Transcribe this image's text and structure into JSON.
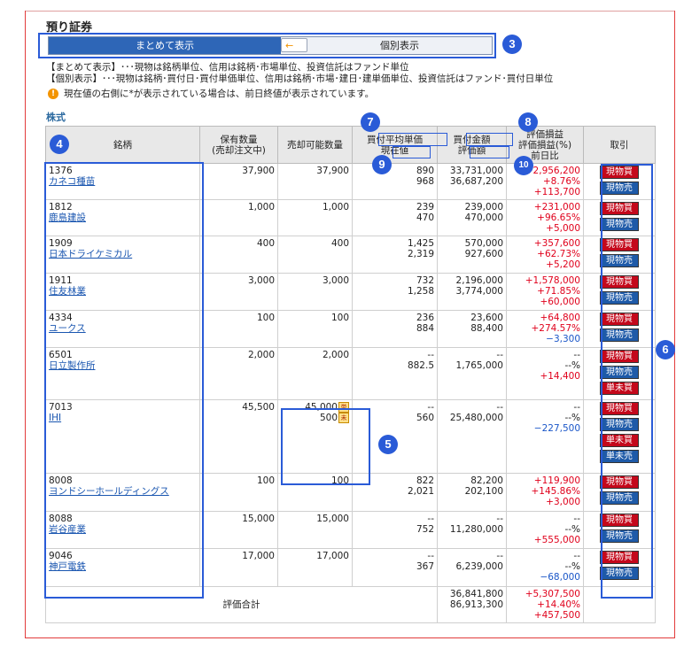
{
  "title": "預り証券",
  "toggle": {
    "left_label": "まとめて表示",
    "right_label": "個別表示",
    "arrow": "←"
  },
  "notes": [
    "【まとめて表示】･･･現物は銘柄単位、信用は銘柄･市場単位、投資信託はファンド単位",
    "【個別表示】･･･現物は銘柄･買付日･買付単価単位、信用は銘柄･市場･建日･建単価単位、投資信託はファンド･買付日単位"
  ],
  "warning": "現在値の右側に*が表示されている場合は、前日終値が表示されています。",
  "section_label": "株式",
  "headers": {
    "name": "銘柄",
    "holdings": [
      "保有数量",
      "(売却注文中)"
    ],
    "sellable": "売却可能数量",
    "avg_price": "買付平均単価",
    "current_price": "現在値",
    "purchase_amount": "買付金額",
    "valuation": "評価額",
    "pnl": [
      "評価損益",
      "評価損益(%)",
      "前日比"
    ],
    "trade": "取引"
  },
  "buttons": {
    "buy": "現物買",
    "sell": "現物売",
    "margin_sell": "単未買",
    "margin_close": "単未売"
  },
  "tags": {
    "a": "単",
    "b": "未"
  },
  "rows": [
    {
      "code": "1376",
      "name": "カネコ種苗",
      "holdings": "37,900",
      "sellable": [
        "37,900"
      ],
      "avg": "890",
      "cur": "968",
      "purchase": "33,731,000",
      "valuation": "36,687,200",
      "pnl": "+2,956,200",
      "pnl_pct": "+8.76%",
      "day": "+113,700",
      "pnl_class": "pos",
      "pct_class": "pos",
      "day_class": "pos",
      "buttons": [
        "buy",
        "sell"
      ]
    },
    {
      "code": "1812",
      "name": "鹿島建設",
      "holdings": "1,000",
      "sellable": [
        "1,000"
      ],
      "avg": "239",
      "cur": "470",
      "purchase": "239,000",
      "valuation": "470,000",
      "pnl": "+231,000",
      "pnl_pct": "+96.65%",
      "day": "+5,000",
      "pnl_class": "pos",
      "pct_class": "pos",
      "day_class": "pos",
      "buttons": [
        "buy",
        "sell"
      ]
    },
    {
      "code": "1909",
      "name": "日本ドライケミカル",
      "holdings": "400",
      "sellable": [
        "400"
      ],
      "avg": "1,425",
      "cur": "2,319",
      "purchase": "570,000",
      "valuation": "927,600",
      "pnl": "+357,600",
      "pnl_pct": "+62.73%",
      "day": "+5,200",
      "pnl_class": "pos",
      "pct_class": "pos",
      "day_class": "pos",
      "buttons": [
        "buy",
        "sell"
      ]
    },
    {
      "code": "1911",
      "name": "住友林業",
      "holdings": "3,000",
      "sellable": [
        "3,000"
      ],
      "avg": "732",
      "cur": "1,258",
      "purchase": "2,196,000",
      "valuation": "3,774,000",
      "pnl": "+1,578,000",
      "pnl_pct": "+71.85%",
      "day": "+60,000",
      "pnl_class": "pos",
      "pct_class": "pos",
      "day_class": "pos",
      "buttons": [
        "buy",
        "sell"
      ]
    },
    {
      "code": "4334",
      "name": "ユークス",
      "holdings": "100",
      "sellable": [
        "100"
      ],
      "avg": "236",
      "cur": "884",
      "purchase": "23,600",
      "valuation": "88,400",
      "pnl": "+64,800",
      "pnl_pct": "+274.57%",
      "day": "−3,300",
      "pnl_class": "pos",
      "pct_class": "pos",
      "day_class": "neg",
      "buttons": [
        "buy",
        "sell"
      ]
    },
    {
      "code": "6501",
      "name": "日立製作所",
      "holdings": "2,000",
      "sellable": [
        "2,000"
      ],
      "avg": "--",
      "cur": "882.5",
      "purchase": "--",
      "valuation": "1,765,000",
      "pnl": "--",
      "pnl_pct": "--%",
      "day": "+14,400",
      "pnl_class": "",
      "pct_class": "",
      "day_class": "pos",
      "buttons": [
        "buy",
        "sell",
        "margin_sell"
      ]
    },
    {
      "code": "7013",
      "name": "IHI",
      "holdings": "45,500",
      "sellable": [
        "45,000",
        "500"
      ],
      "avg": "--",
      "cur": "560",
      "purchase": "--",
      "valuation": "25,480,000",
      "pnl": "--",
      "pnl_pct": "--%",
      "day": "−227,500",
      "pnl_class": "",
      "pct_class": "",
      "day_class": "neg",
      "buttons": [
        "buy",
        "sell",
        "margin_sell",
        "margin_close"
      ]
    },
    {
      "code": "8008",
      "name": "ヨンドシーホールディングス",
      "holdings": "100",
      "sellable": [
        "100"
      ],
      "avg": "822",
      "cur": "2,021",
      "purchase": "82,200",
      "valuation": "202,100",
      "pnl": "+119,900",
      "pnl_pct": "+145.86%",
      "day": "+3,000",
      "pnl_class": "pos",
      "pct_class": "pos",
      "day_class": "pos",
      "buttons": [
        "buy",
        "sell"
      ]
    },
    {
      "code": "8088",
      "name": "岩谷産業",
      "holdings": "15,000",
      "sellable": [
        "15,000"
      ],
      "avg": "--",
      "cur": "752",
      "purchase": "--",
      "valuation": "11,280,000",
      "pnl": "--",
      "pnl_pct": "--%",
      "day": "+555,000",
      "pnl_class": "",
      "pct_class": "",
      "day_class": "pos",
      "buttons": [
        "buy",
        "sell"
      ]
    },
    {
      "code": "9046",
      "name": "神戸電鉄",
      "holdings": "17,000",
      "sellable": [
        "17,000"
      ],
      "avg": "--",
      "cur": "367",
      "purchase": "--",
      "valuation": "6,239,000",
      "pnl": "--",
      "pnl_pct": "--%",
      "day": "−68,000",
      "pnl_class": "",
      "pct_class": "",
      "day_class": "neg",
      "buttons": [
        "buy",
        "sell"
      ]
    }
  ],
  "total": {
    "label": "評価合計",
    "purchase": "36,841,800",
    "valuation": "86,913,300",
    "pnl": "+5,307,500",
    "pnl_pct": "+14.40%",
    "day": "+457,500"
  },
  "badges": {
    "b3": "3",
    "b4": "4",
    "b5": "5",
    "b6": "6",
    "b7": "7",
    "b8": "8",
    "b9": "9",
    "b10": "10"
  }
}
